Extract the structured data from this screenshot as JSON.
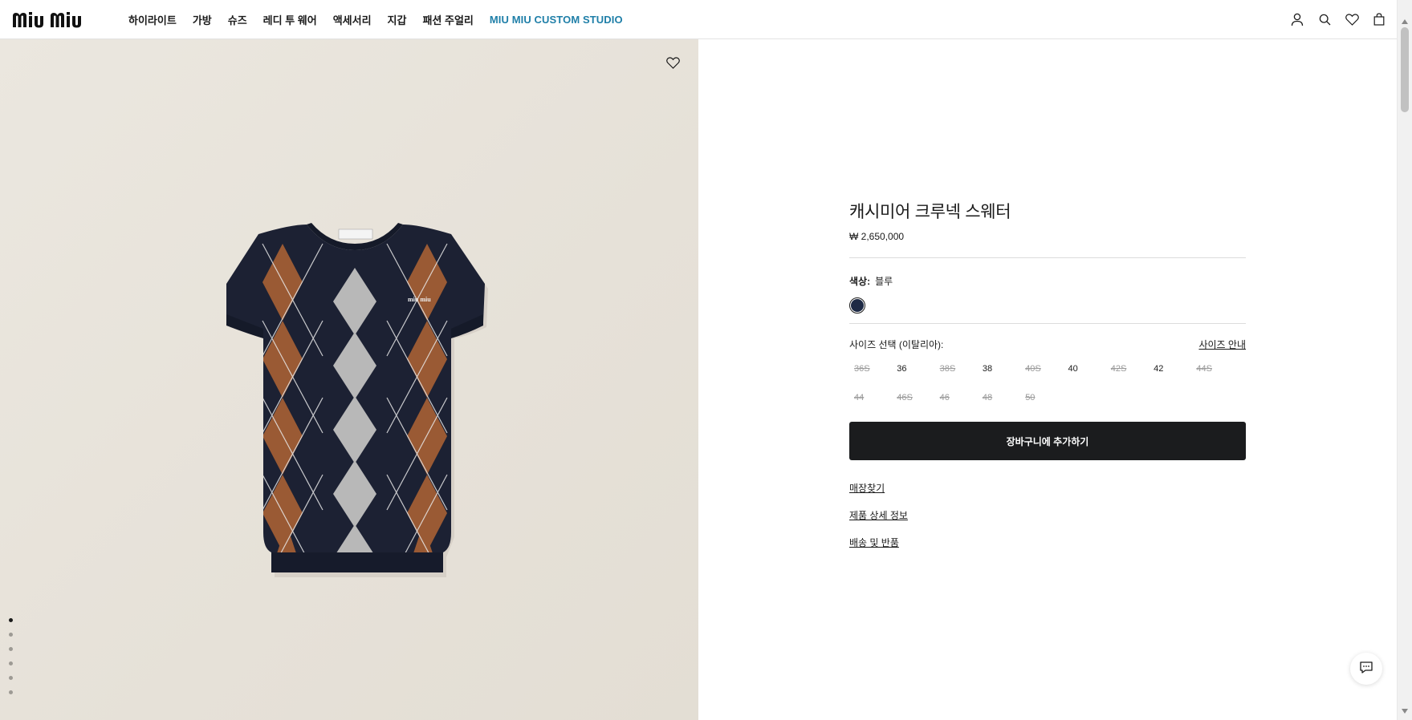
{
  "header": {
    "logo_text": "MIU MIU",
    "nav": [
      {
        "label": "하이라이트"
      },
      {
        "label": "가방"
      },
      {
        "label": "슈즈"
      },
      {
        "label": "레디 투 웨어"
      },
      {
        "label": "액세서리"
      },
      {
        "label": "지갑"
      },
      {
        "label": "패션 주얼리"
      },
      {
        "label": "MIU MIU CUSTOM STUDIO"
      }
    ],
    "accent_color": "#1f7fa8",
    "icons": [
      "user-icon",
      "search-icon",
      "heart-icon",
      "bag-icon"
    ]
  },
  "media": {
    "image": "argyle-sweater",
    "slide_count": 6,
    "active_slide": 1
  },
  "product": {
    "title": "캐시미어 크루넥 스웨터",
    "price": "₩ 2,650,000",
    "color_label": "색상:",
    "color_value": "블루",
    "swatch_color": "#1e2a45",
    "size_title": "사이즈 선택 (이탈리아):",
    "size_guide": "사이즈 안내",
    "sizes": [
      {
        "label": "36S",
        "available": false
      },
      {
        "label": "36",
        "available": true
      },
      {
        "label": "38S",
        "available": false
      },
      {
        "label": "38",
        "available": true
      },
      {
        "label": "40S",
        "available": false
      },
      {
        "label": "40",
        "available": true
      },
      {
        "label": "42S",
        "available": false
      },
      {
        "label": "42",
        "available": true
      },
      {
        "label": "44S",
        "available": false
      },
      {
        "label": "44",
        "available": false
      },
      {
        "label": "46S",
        "available": false
      },
      {
        "label": "46",
        "available": false
      },
      {
        "label": "48",
        "available": false
      },
      {
        "label": "50",
        "available": false
      }
    ],
    "add_to_cart": "장바구니에 추가하기",
    "links": [
      "매장찾기",
      "제품 상세 정보",
      "배송 및 반품"
    ]
  }
}
